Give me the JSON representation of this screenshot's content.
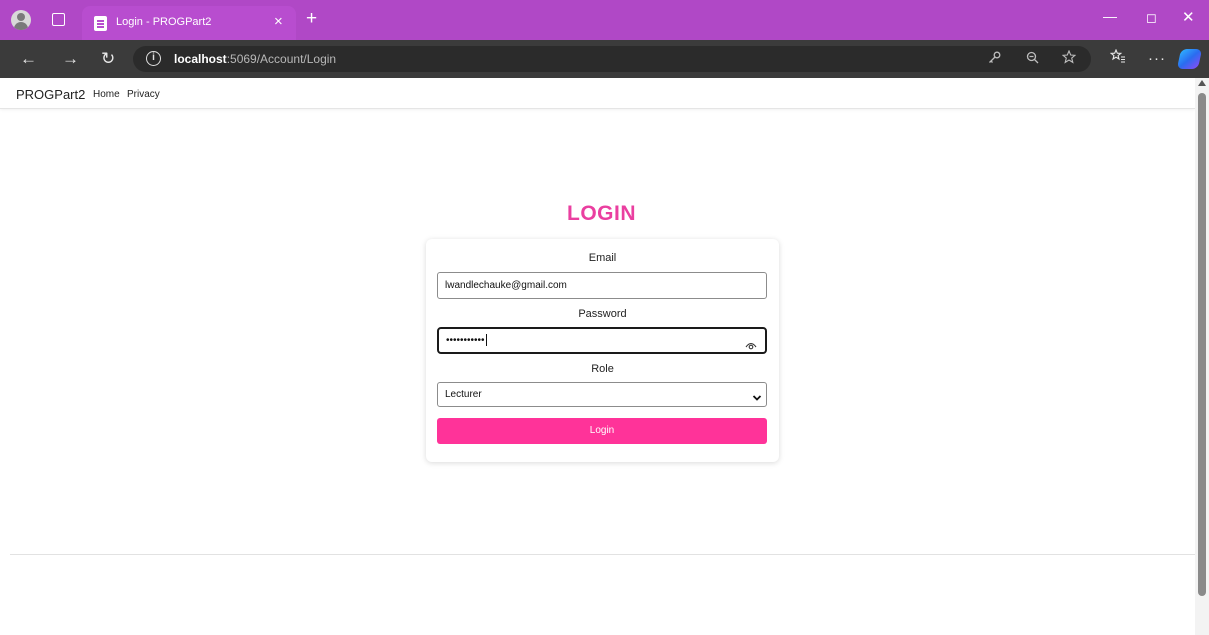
{
  "browser": {
    "tab_title": "Login - PROGPart2",
    "tab_close": "×",
    "new_tab": "+",
    "url_host": "localhost",
    "url_path": ":5069/Account/Login",
    "nav": {
      "back": "←",
      "forward": "→",
      "refresh": "↻"
    },
    "window": {
      "minimize": "—",
      "maximize": "◻",
      "close": "✕"
    },
    "toolbar_icons": [
      "key-icon",
      "zoom-icon",
      "star-icon",
      "favorites-icon",
      "more-icon",
      "copilot-icon"
    ]
  },
  "site_nav": {
    "brand": "PROGPart2",
    "links": [
      "Home",
      "Privacy"
    ]
  },
  "login": {
    "title": "LOGIN",
    "email_label": "Email",
    "email_value": "lwandlechauke@gmail.com",
    "password_label": "Password",
    "password_value": "•••••••••••",
    "role_label": "Role",
    "role_value": "Lecturer",
    "button_label": "Login"
  },
  "colors": {
    "titlebar": "#b048c6",
    "accent_title": "#ea3fa0",
    "button": "#ff3399"
  }
}
